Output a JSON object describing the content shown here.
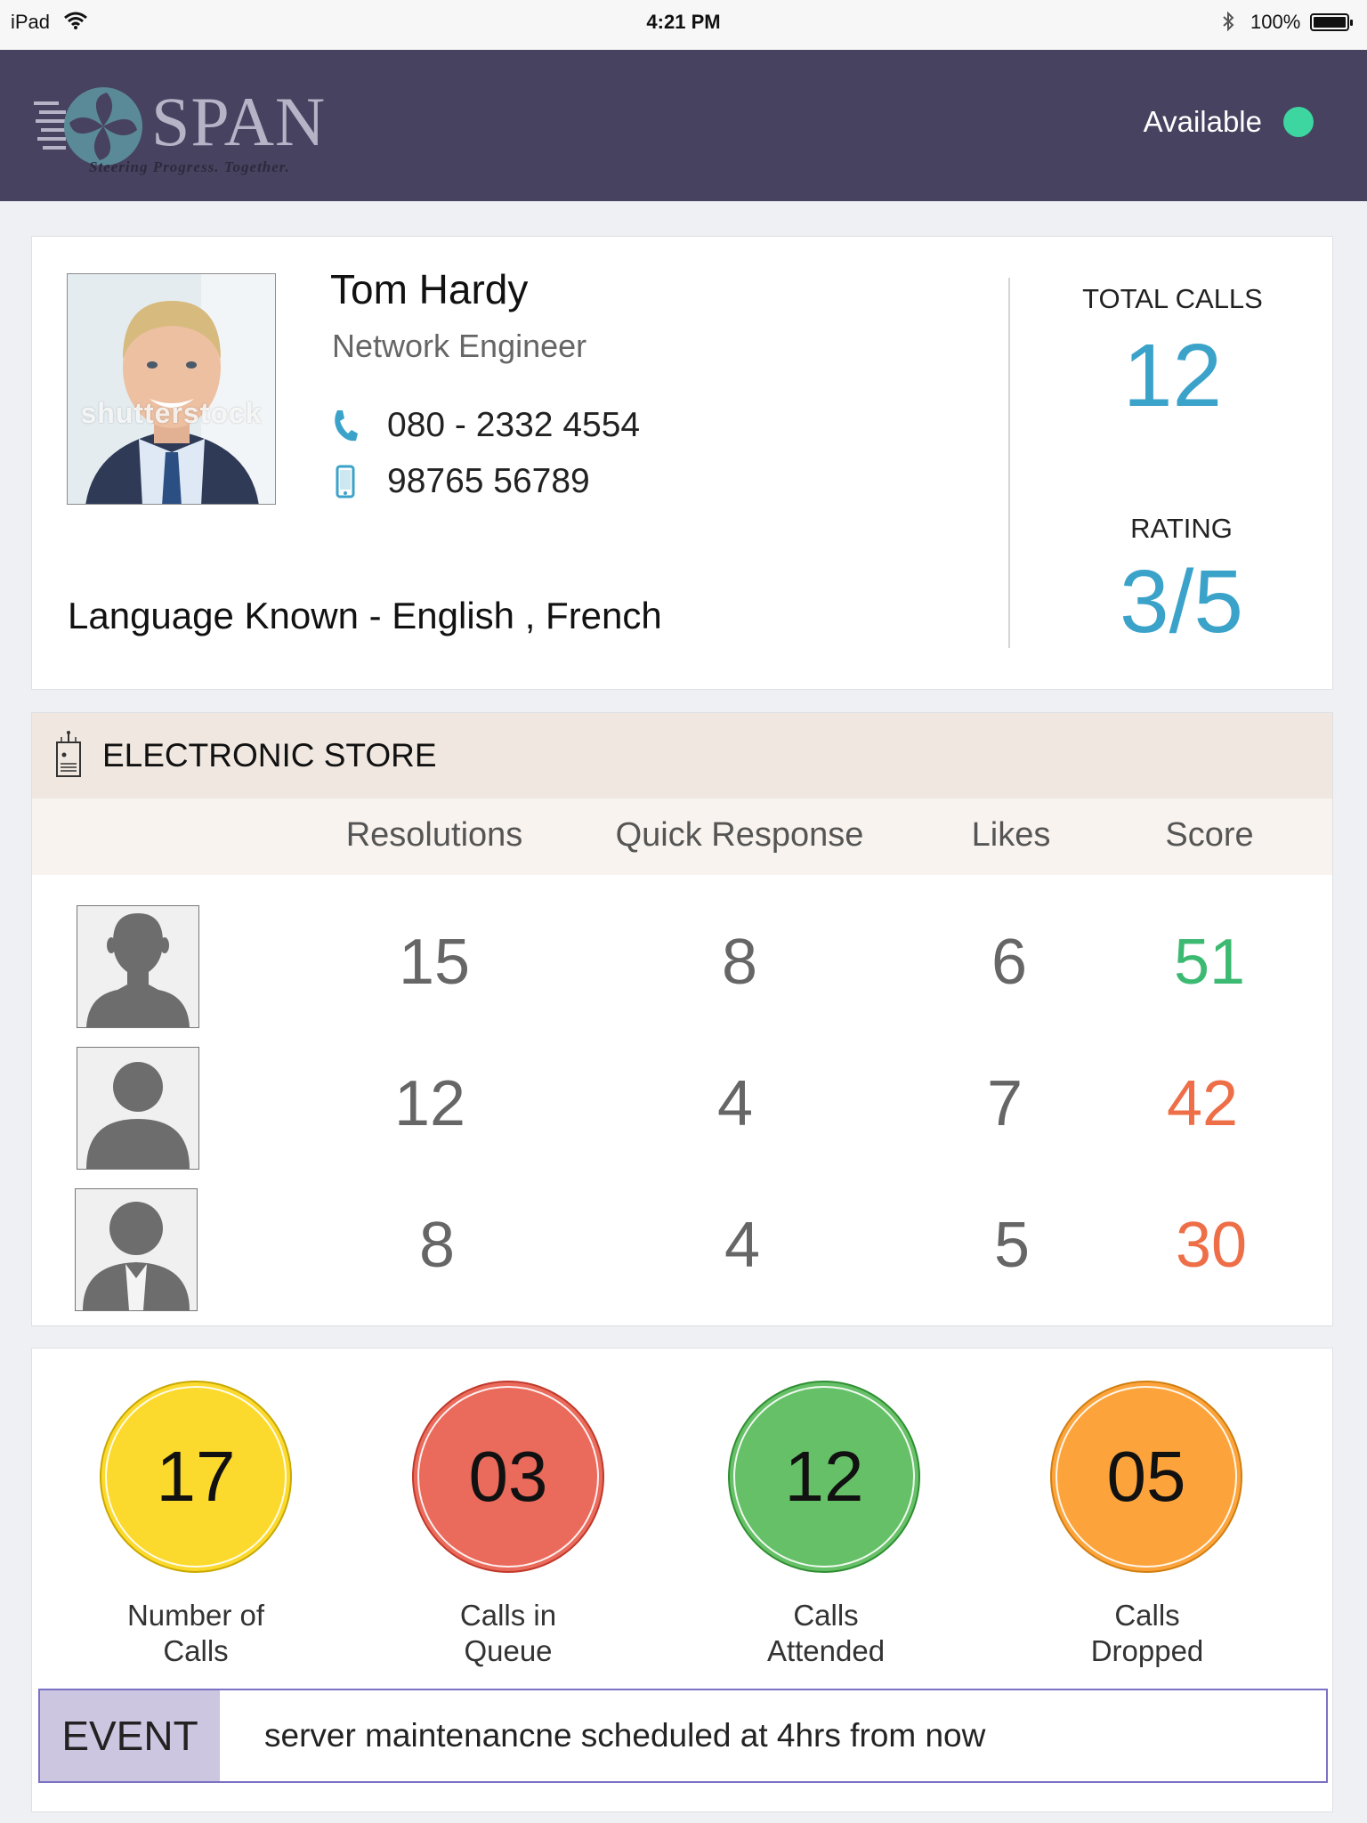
{
  "status_bar": {
    "device": "iPad",
    "time": "4:21 PM",
    "battery": "100%"
  },
  "header": {
    "logo_text": "SPAN",
    "logo_tagline": "Steering Progress. Together.",
    "availability_label": "Available",
    "availability_color": "#3dd6a0",
    "background_color": "#474260"
  },
  "profile": {
    "photo_watermark": "shutterstock",
    "name": "Tom Hardy",
    "role": "Network Engineer",
    "phone_icon": "phone-icon",
    "phone": "080 - 2332 4554",
    "mobile_icon": "mobile-icon",
    "mobile": "98765 56789",
    "languages": "Language Known - English , French",
    "total_calls_label": "TOTAL CALLS",
    "total_calls_value": "12",
    "rating_label": "RATING",
    "rating_value": "3/5",
    "accent_color": "#3ba3c9"
  },
  "store": {
    "title": "ELECTRONIC STORE",
    "icon": "store-device-icon",
    "columns": [
      "Resolutions",
      "Quick Response",
      "Likes",
      "Score"
    ],
    "rows": [
      {
        "avatar": "male-silhouette-icon",
        "resolutions": "15",
        "quick_response": "8",
        "likes": "6",
        "score": "51",
        "score_color": "#3cba72"
      },
      {
        "avatar": "user-silhouette-icon",
        "resolutions": "12",
        "quick_response": "4",
        "likes": "7",
        "score": "42",
        "score_color": "#ee6e47"
      },
      {
        "avatar": "user-tie-silhouette-icon",
        "resolutions": "8",
        "quick_response": "4",
        "likes": "5",
        "score": "30",
        "score_color": "#ee6e47"
      }
    ]
  },
  "summary": {
    "tiles": [
      {
        "value": "17",
        "label_line1": "Number of",
        "label_line2": "Calls",
        "color": "#fcd92d"
      },
      {
        "value": "03",
        "label_line1": "Calls in",
        "label_line2": "Queue",
        "color": "#ea6a5b"
      },
      {
        "value": "12",
        "label_line1": "Calls",
        "label_line2": "Attended",
        "color": "#66c067"
      },
      {
        "value": "05",
        "label_line1": "Calls",
        "label_line2": "Dropped",
        "color": "#fca43b"
      }
    ],
    "event_tag": "EVENT",
    "event_message": "server maintenancne scheduled at 4hrs from now"
  }
}
